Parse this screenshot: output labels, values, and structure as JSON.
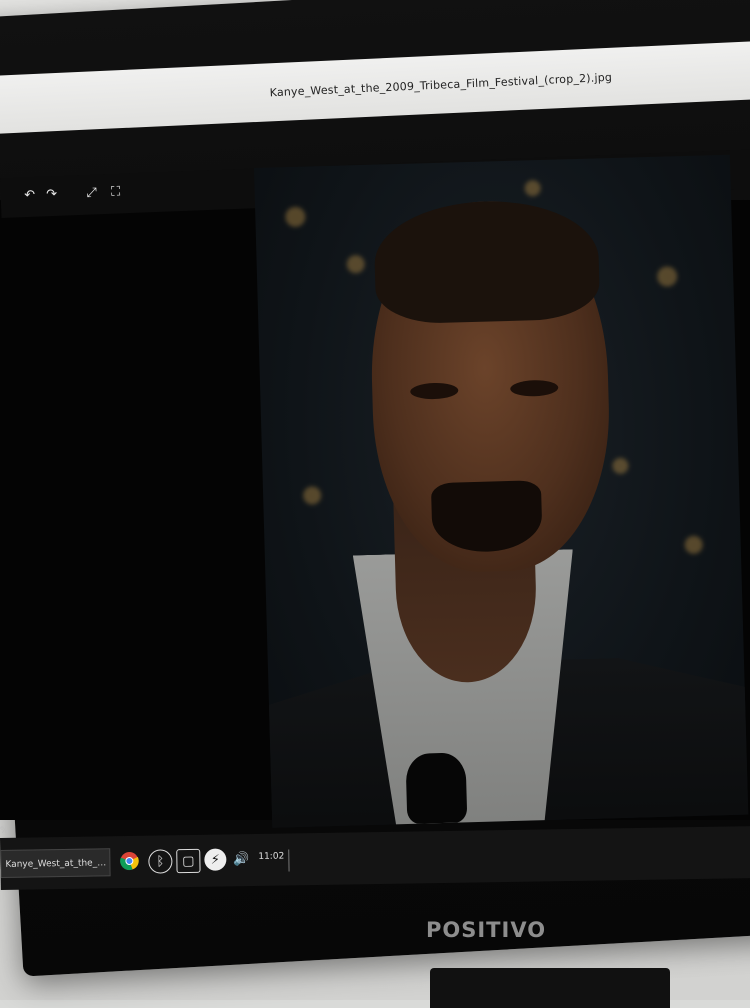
{
  "window": {
    "title": "Kanye_West_at_the_2009_Tribeca_Film_Festival_(crop_2).jpg"
  },
  "toolbar": {
    "buttons": [
      {
        "name": "rotate-left-icon",
        "glyph": "↶"
      },
      {
        "name": "rotate-right-icon",
        "glyph": "↷"
      },
      {
        "name": "fullscreen-icon",
        "glyph": "⤢"
      },
      {
        "name": "slideshow-icon",
        "glyph": "⛶"
      }
    ]
  },
  "viewer": {
    "zoom_fragment": "%"
  },
  "taskbar": {
    "task_label": "Kanye_West_at_the_200...",
    "tray": [
      {
        "name": "chrome-icon"
      },
      {
        "name": "bluetooth-icon",
        "glyph": "ᛒ"
      },
      {
        "name": "files-icon",
        "glyph": "▢"
      },
      {
        "name": "power-icon",
        "glyph": "⚡"
      },
      {
        "name": "volume-icon",
        "glyph": "🔊"
      }
    ],
    "clock": "11:02"
  },
  "monitor": {
    "brand": "POSITIVO"
  }
}
